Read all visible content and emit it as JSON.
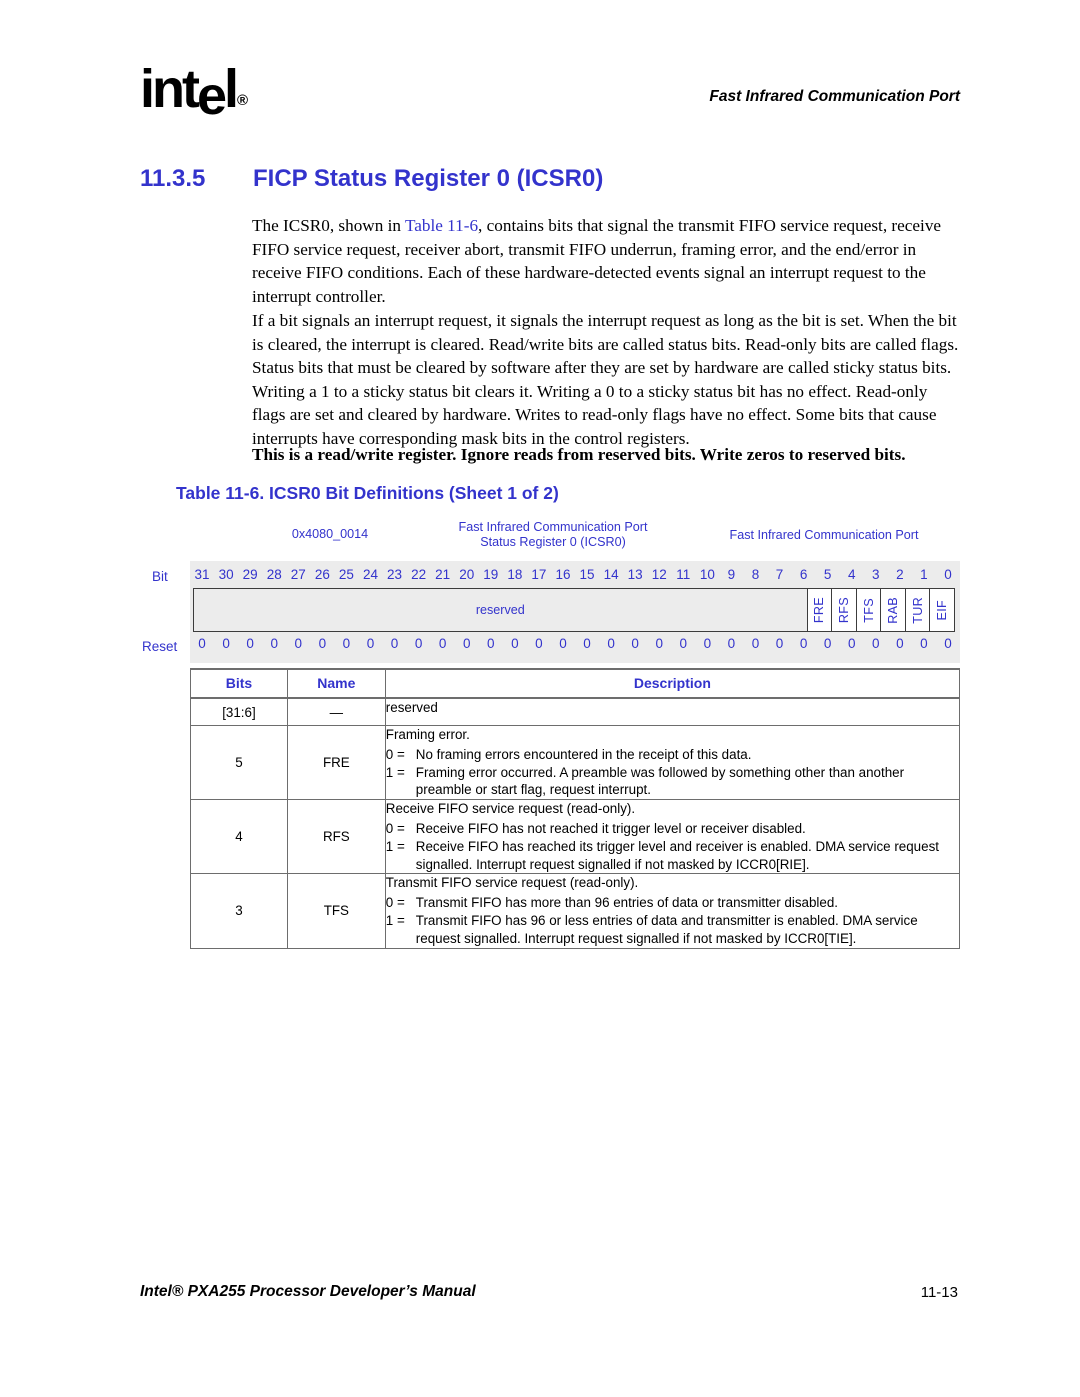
{
  "header": {
    "logo_text": "intel",
    "logo_reg": "®",
    "chapter_title": "Fast Infrared Communication Port"
  },
  "section": {
    "number": "11.3.5",
    "title": "FICP Status Register 0 (ICSR0)"
  },
  "paragraphs": {
    "p1_before": "The ICSR0, shown in ",
    "p1_link": "Table 11-6",
    "p1_after": ", contains bits that signal the transmit FIFO service request, receive FIFO service request, receiver abort, transmit FIFO underrun, framing error, and the end/error in receive FIFO conditions. Each of these hardware-detected events signal an interrupt request to the interrupt controller.",
    "p2": "If a bit signals an interrupt request, it signals the interrupt request as long as the bit is set. When the bit is cleared, the interrupt is cleared. Read/write bits are called status bits. Read-only bits are called flags. Status bits that must be cleared by software after they are set by hardware are called sticky status bits. Writing a 1 to a sticky status bit clears it. Writing a 0 to a sticky status bit has no effect. Read-only flags are set and cleared by hardware. Writes to read-only flags have no effect. Some bits that cause interrupts have corresponding mask bits in the control registers.",
    "note": "This is a read/write register. Ignore reads from reserved bits. Write zeros to reserved bits."
  },
  "table_caption": "Table 11-6. ICSR0 Bit Definitions (Sheet 1 of 2)",
  "register_diagram": {
    "address": "0x4080_0014",
    "register_name_line1": "Fast Infrared Communication Port",
    "register_name_line2": "Status Register 0 (ICSR0)",
    "unit_name": "Fast Infrared Communication Port",
    "bit_axis_label": "Bit",
    "reset_axis_label": "Reset",
    "bit_numbers": [
      "31",
      "30",
      "29",
      "28",
      "27",
      "26",
      "25",
      "24",
      "23",
      "22",
      "21",
      "20",
      "19",
      "18",
      "17",
      "16",
      "15",
      "14",
      "13",
      "12",
      "11",
      "10",
      "9",
      "8",
      "7",
      "6",
      "5",
      "4",
      "3",
      "2",
      "1",
      "0"
    ],
    "reserved_field_label": "reserved",
    "named_fields": [
      "FRE",
      "RFS",
      "TFS",
      "RAB",
      "TUR",
      "EIF"
    ],
    "reset_values": [
      "0",
      "0",
      "0",
      "0",
      "0",
      "0",
      "0",
      "0",
      "0",
      "0",
      "0",
      "0",
      "0",
      "0",
      "0",
      "0",
      "0",
      "0",
      "0",
      "0",
      "0",
      "0",
      "0",
      "0",
      "0",
      "0",
      "0",
      "0",
      "0",
      "0",
      "0",
      "0"
    ],
    "accent_color": "#3333CC"
  },
  "bit_table": {
    "columns": [
      "Bits",
      "Name",
      "Description"
    ],
    "rows": [
      {
        "bits": "[31:6]",
        "name": "—",
        "lead": "reserved",
        "options": []
      },
      {
        "bits": "5",
        "name": "FRE",
        "lead": "Framing error.",
        "options": [
          {
            "key": "0 =",
            "value": "No framing errors encountered in the receipt of this data."
          },
          {
            "key": "1 =",
            "value": "Framing error occurred. A preamble was followed by something other than another preamble or start flag, request interrupt."
          }
        ]
      },
      {
        "bits": "4",
        "name": "RFS",
        "lead": "Receive FIFO service request (read-only).",
        "options": [
          {
            "key": "0 =",
            "value": "Receive FIFO has not reached it trigger level or receiver disabled."
          },
          {
            "key": "1 =",
            "value": "Receive FIFO has reached its trigger level and receiver is enabled. DMA service request signalled. Interrupt request signalled if not masked by ICCR0[RIE]."
          }
        ]
      },
      {
        "bits": "3",
        "name": "TFS",
        "lead": "Transmit FIFO service request (read-only).",
        "options": [
          {
            "key": "0 =",
            "value": "Transmit FIFO has more than 96 entries of data or transmitter disabled."
          },
          {
            "key": "1 =",
            "value": "Transmit FIFO has 96 or less entries of data and transmitter is enabled. DMA service request signalled. Interrupt request signalled if not masked by ICCR0[TIE]."
          }
        ]
      }
    ]
  },
  "footer": {
    "manual_title": "Intel® PXA255 Processor Developer’s Manual",
    "page_number": "11-13"
  }
}
